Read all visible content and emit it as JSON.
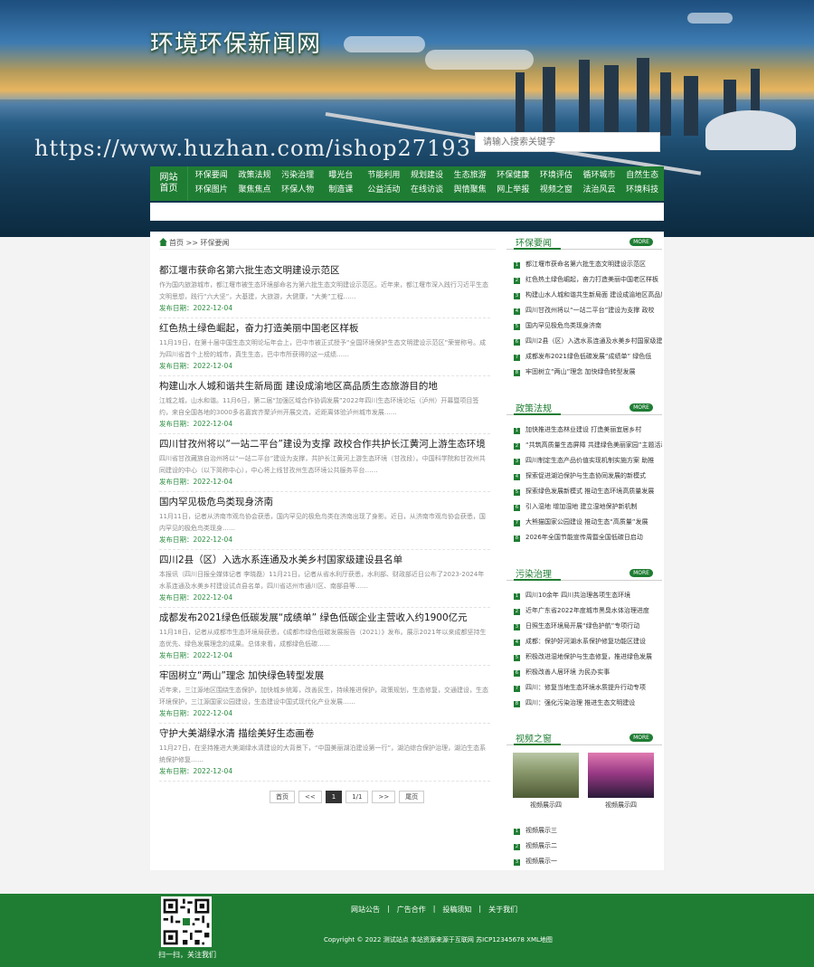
{
  "header": {
    "site_title": "环境环保新闻网",
    "watermark": "https://www.huzhan.com/ishop27193",
    "search_placeholder": "请输入搜索关键字"
  },
  "nav": {
    "home_label_1": "网站",
    "home_label_2": "首页",
    "items": [
      "环保要闻",
      "政策法规",
      "污染治理",
      "曝光台",
      "节能利用",
      "规划建设",
      "生态旅游",
      "环保健康",
      "环境评估",
      "循环城市",
      "自然生态",
      "环保图片",
      "聚焦焦点",
      "环保人物",
      "制造课",
      "公益活动",
      "在线访谈",
      "舆情聚焦",
      "网上举报",
      "视频之窗",
      "法治风云",
      "环境科技"
    ]
  },
  "breadcrumb": {
    "home": "首页",
    "sep": ">>",
    "current": "环保要闻"
  },
  "news": [
    {
      "title": "都江堰市获命名第六批生态文明建设示范区",
      "desc": "作为国内旅游城市，都江堰市被生态环境部命名为第六批生态文明建设示范区。近年来，都江堰市深入践行习近平生态文明思想，践行“六大坚”，大基建，大旅游，大健康，“大美”工程……",
      "date": "发布日期：2022-12-04"
    },
    {
      "title": "红色热土绿色崛起，奋力打造美丽中国老区样板",
      "desc": "11月19日，在第十届中国生态文明论坛年会上，巴中市被正式授予“全国环境保护生态文明建设示范区”荣誉称号。成为四川省首个上榜的城市，真生生态，巴中市所获得的这一成绩……",
      "date": "发布日期：2022-12-04"
    },
    {
      "title": "构建山水人城和谐共生新局面 建设成渝地区高品质生态旅游目的地",
      "desc": "江城之城，山水和谐。11月6日，第二届“加强区域合作协调发展”2022年四川生态环境论坛（泸州）开幕暨项目签约，来自全国各地的3000多名嘉宾齐聚泸州开展交流，近距离体验泸州城市发展……",
      "date": "发布日期：2022-12-04"
    },
    {
      "title": "四川甘孜州将以“一站二平台”建设为支撑 政校合作共护长江黄河上游生态环境",
      "desc": "四川省甘孜藏族自治州将以“一站二平台”建设为支撑，共护长江黄河上游生态环境（甘孜段）。中国科学院和甘孜州共同建设的中心（以下简称中心），中心将上线甘孜州生态环境公共服务平台……",
      "date": "发布日期：2022-12-04"
    },
    {
      "title": "国内罕见极危鸟类现身济南",
      "desc": "11月11日，记者从济南市观鸟协会获悉，国内罕见的极危鸟类在济南出现了身影。近日，从济南市观鸟协会获悉，国内罕见的极危鸟类现身……",
      "date": "发布日期：2022-12-04"
    },
    {
      "title": "四川2县（区）入选水系连通及水美乡村国家级建设县名单",
      "desc": "本报讯（四川日报全媒体记者 李晓磊）11月21日，记者从省水利厅获悉，水利部、财政部近日公布了2023-2024年水系连通及水美乡村建设试点县名单，四川省达州市通川区、南部县等……",
      "date": "发布日期：2022-12-04"
    },
    {
      "title": "成都发布2021绿色低碳发展“成绩单” 绿色低碳企业主营收入约1900亿元",
      "desc": "11月18日，记者从成都市生态环境局获悉，《成都市绿色低碳发展报告（2021）》发布。展示2021年以来成都坚持生态优先、绿色发展理念的成果。总体来看，成都绿色低碳……",
      "date": "发布日期：2022-12-04"
    },
    {
      "title": "牢固树立“两山”理念 加快绿色转型发展",
      "desc": "近年来，三江源地区围绕生态保护，加快城乡统筹，改善民生，持续推进保护，政策规划，生态修复，交通建设，生态环境保护，三江源国家公园建设，生态建设中国式现代化产业发展……",
      "date": "发布日期：2022-12-04"
    },
    {
      "title": "守护大美湖绿水清 描绘美好生态画卷",
      "desc": "11月27日，在坚持推进大美湖绿水清建设的大背景下，“中国美丽湖泊建设第一行”，湖泊综合保护治理，湖泊生态系统保护修复……",
      "date": "发布日期：2022-12-04"
    }
  ],
  "pager": [
    "首页",
    "<<",
    "1",
    "1/1",
    ">>",
    "尾页"
  ],
  "pager_current_index": 2,
  "sidebar": {
    "more_label": "MORE",
    "blocks": [
      {
        "title": "环保要闻",
        "items": [
          "都江堰市获命名第六批生态文明建设示范区",
          "红色热土绿色崛起，奋力打造美丽中国老区样板",
          "构建山水人城和谐共生新局面 建设成渝地区高品质",
          "四川甘孜州将以“一站二平台”建设为支撑 政校",
          "国内罕见极危鸟类现身济南",
          "四川2县（区）入选水系连通及水美乡村国家级建",
          "成都发布2021绿色低碳发展“成绩单” 绿色低",
          "牢固树立“两山”理念 加快绿色转型发展"
        ]
      },
      {
        "title": "政策法规",
        "items": [
          "加快推进生态林业建设 打造美丽宜居乡村",
          "“共筑高质量生态屏障 共建绿色美丽家园”主题活动",
          "四川制定生态产品价值实现机制实施方案 助推",
          "探索促进湖泊保护与生态协同发展的新模式",
          "探索绿色发展新模式 推动生态环境高质量发展",
          "引入湿地 增加湿地 建立湿地保护新机制",
          "大熊猫国家公园建设 推动生态“高质量”发展",
          "2026年全国节能宣传周暨全国低碳日启动"
        ]
      },
      {
        "title": "污染治理",
        "items": [
          "四川10余年 四川共治理各项生态环境",
          "近年广东省2022年度城市黑臭水体治理进度",
          "日照生态环境局开展“绿色护航”专项行动",
          "成都：保护好河湖水系保护修复功能区建设",
          "积极改进湿地保护与生态修复，推进绿色发展",
          "积极改善人居环境 为民办实事",
          "四川：修复当地生态环境水质提升行动专项",
          "四川：强化污染治理 推进生态文明建设"
        ]
      },
      {
        "title": "视频之窗",
        "videos": [
          "视频展示四",
          "视频展示四"
        ],
        "items": [
          "视频展示三",
          "视频展示二",
          "视频展示一"
        ]
      }
    ]
  },
  "footer": {
    "qr_label": "扫一扫，关注我们",
    "links": [
      "网站公告",
      "广告合作",
      "投稿须知",
      "关于我们"
    ],
    "copyright": "Copyright © 2022 测试站点 本站资源来源于互联网 苏ICP12345678 XML地图"
  },
  "colors": {
    "brand_green": "#1f7d33",
    "footer_bg": "#1f7d33"
  }
}
